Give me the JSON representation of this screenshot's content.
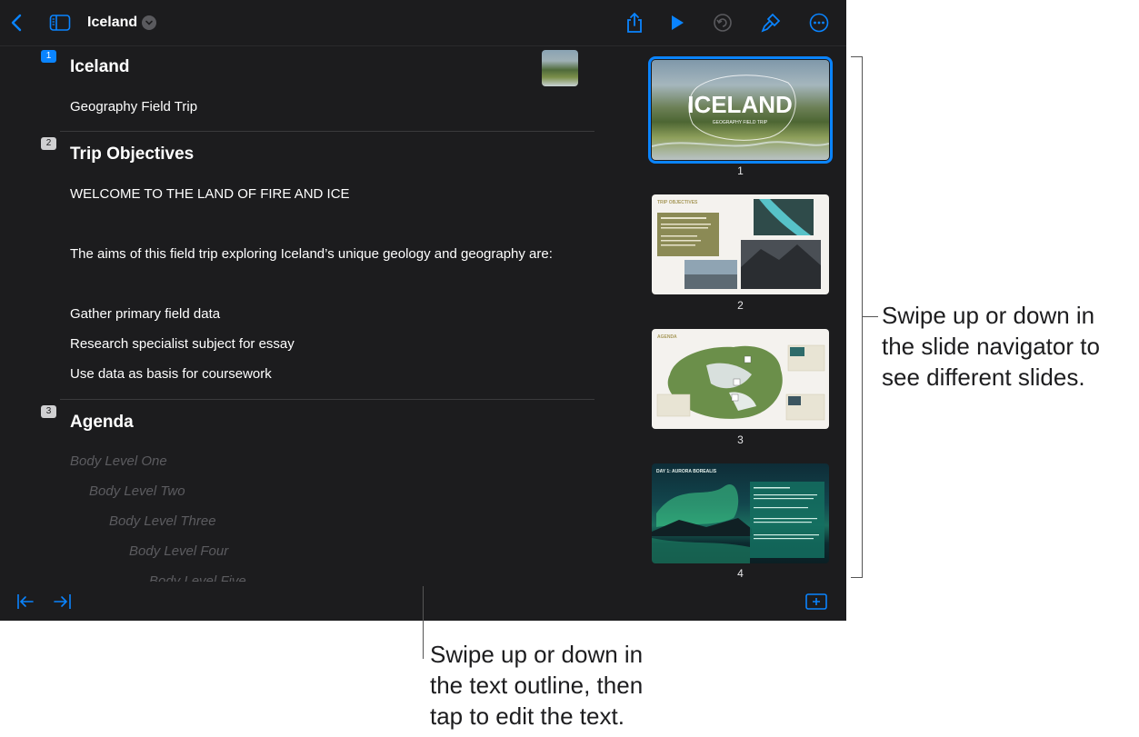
{
  "toolbar": {
    "title": "Iceland"
  },
  "outline": {
    "slides": [
      {
        "number": "1",
        "title": "Iceland",
        "body": [
          "Geography Field Trip"
        ]
      },
      {
        "number": "2",
        "title": "Trip Objectives",
        "body": [
          "WELCOME TO THE LAND OF FIRE AND ICE",
          "The aims of this field trip exploring Iceland’s unique geology and geography are:",
          "Gather primary field data",
          "Research specialist subject for essay",
          "Use data as basis for coursework"
        ]
      },
      {
        "number": "3",
        "title": "Agenda",
        "placeholders": [
          "Body Level One",
          "Body Level Two",
          "Body Level Three",
          "Body Level Four",
          "Body Level Five"
        ]
      }
    ]
  },
  "navigator": {
    "slides": [
      {
        "label": "1",
        "title_text": "ICELAND",
        "subtitle_text": "GEOGRAPHY FIELD TRIP"
      },
      {
        "label": "2",
        "title_text": "TRIP OBJECTIVES"
      },
      {
        "label": "3",
        "title_text": "AGENDA"
      },
      {
        "label": "4",
        "title_text": "DAY 1: AURORA BOREALIS"
      }
    ]
  },
  "callouts": {
    "navigator": [
      "Swipe up or down in",
      "the slide navigator to",
      "see different slides."
    ],
    "outline": [
      "Swipe up or down in",
      "the text outline, then",
      "tap to edit the text."
    ]
  },
  "colors": {
    "accent": "#0a84ff",
    "background": "#1c1c1e"
  }
}
